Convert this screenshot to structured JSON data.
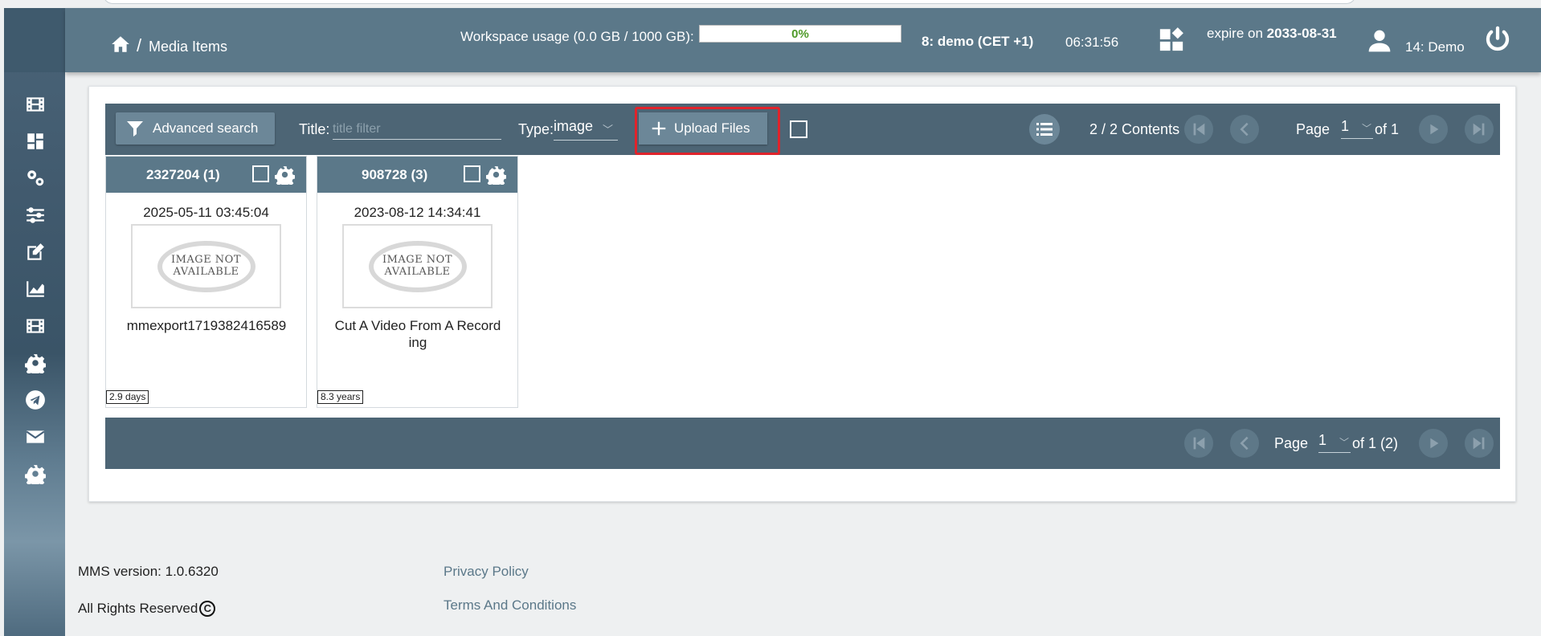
{
  "header": {
    "breadcrumb": "Media Items",
    "breadcrumb_sep": "/",
    "usage_label": "Workspace usage (0.0 GB / 1000 GB):",
    "usage_percent": "0%",
    "usage_fraction": 0.0,
    "user_tz": "8: demo (CET +1)",
    "clock": "06:31:56",
    "expire_prefix": "expire on",
    "expire_date": "2033-08-31",
    "user_name": "14: Demo"
  },
  "sidebar": {
    "items": [
      "film-icon",
      "dashboard-icon",
      "gears-icon",
      "sliders-icon",
      "edit-icon",
      "chart-icon",
      "film-icon",
      "gear-icon",
      "telegram-icon",
      "mail-icon",
      "gear-icon"
    ]
  },
  "toolbar": {
    "advanced_search": "Advanced search",
    "title_label": "Title:",
    "title_placeholder": "title filter",
    "type_label": "Type:",
    "type_value": "image",
    "upload_label": "Upload Files",
    "contents": "2 / 2 Contents",
    "page_label": "Page",
    "page_value": "1",
    "page_of": "of 1"
  },
  "cards": [
    {
      "id": "2327204 (1)",
      "date": "2025-05-11 03:45:04",
      "thumb_text": "IMAGE NOT AVAILABLE",
      "title": "mmexport1719382416589",
      "age": "2.9 days"
    },
    {
      "id": "908728 (3)",
      "date": "2023-08-12 14:34:41",
      "thumb_text": "IMAGE NOT AVAILABLE",
      "title": "Cut A Video From A Recording",
      "age": "8.3 years"
    }
  ],
  "bottom_pager": {
    "page_label": "Page",
    "page_value": "1",
    "page_of": "of 1 (2)"
  },
  "footer": {
    "version": "MMS version: 1.0.6320",
    "rights": "All Rights Reserved",
    "copyright_symbol": "C",
    "privacy": "Privacy Policy",
    "terms": "Terms And Conditions"
  },
  "colors": {
    "header_bg": "#5b7889",
    "toolbar_bg": "#4d6575",
    "button_bg": "#6c8798",
    "highlight": "#e0232b",
    "usage_text": "#4f9a2a"
  }
}
